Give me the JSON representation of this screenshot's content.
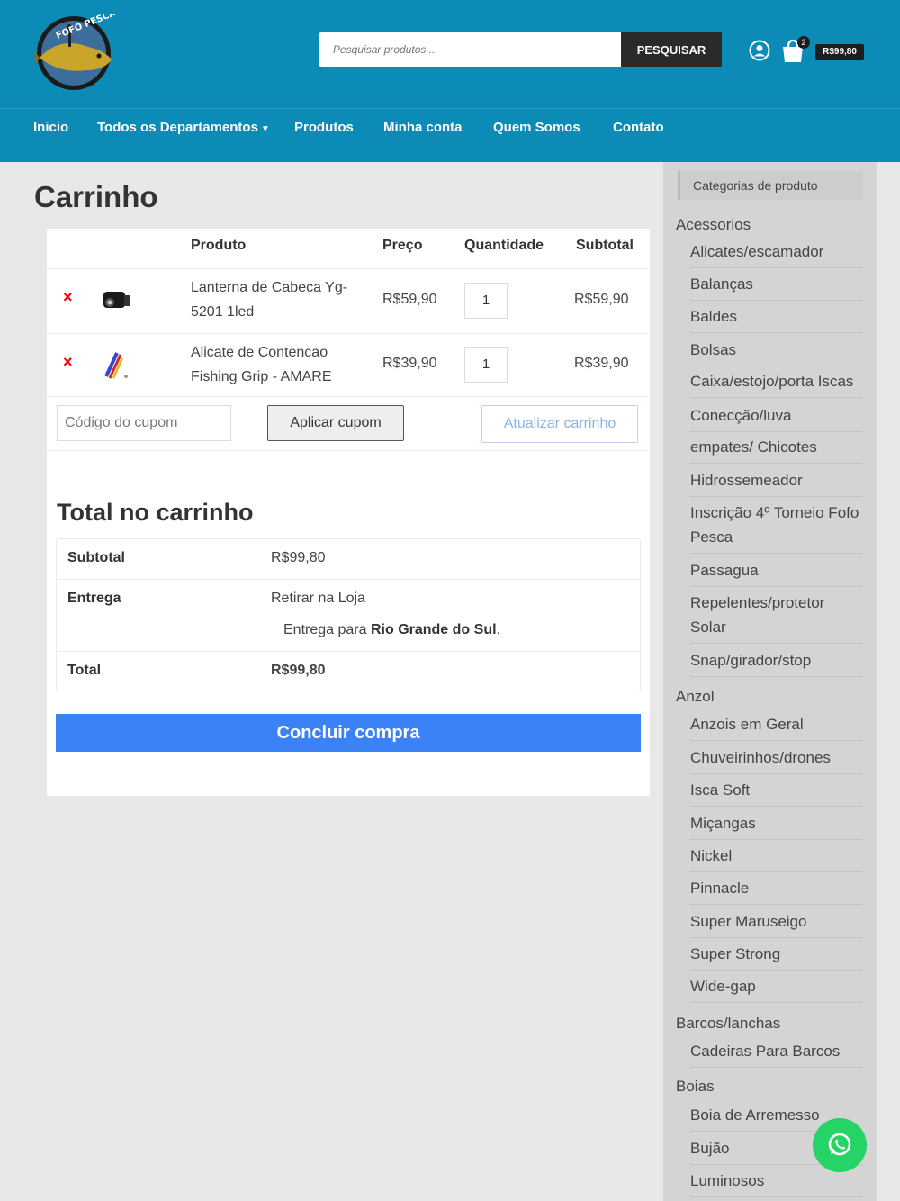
{
  "header": {
    "logo_text": "FOFO PESCA",
    "search_placeholder": "Pesquisar produtos ...",
    "search_button": "PESQUISAR",
    "cart_count": "2",
    "cart_total": "R$99,80"
  },
  "nav": {
    "items": [
      {
        "label": "Inicio"
      },
      {
        "label": "Todos os Departamentos"
      },
      {
        "label": "Produtos"
      },
      {
        "label": "Minha conta"
      },
      {
        "label": "Quem Somos"
      },
      {
        "label": "Contato"
      }
    ]
  },
  "page": {
    "title": "Carrinho"
  },
  "cart": {
    "headers": {
      "product": "Produto",
      "price": "Preço",
      "quantity": "Quantidade",
      "subtotal": "Subtotal"
    },
    "rows": [
      {
        "name": "Lanterna de Cabeca Yg-5201 1led",
        "price": "R$59,90",
        "qty": "1",
        "subtotal": "R$59,90",
        "remove": "×"
      },
      {
        "name": "Alicate de Contencao Fishing Grip - AMARE",
        "price": "R$39,90",
        "qty": "1",
        "subtotal": "R$39,90",
        "remove": "×"
      }
    ],
    "coupon_placeholder": "Código do cupom",
    "apply_coupon": "Aplicar cupom",
    "update_cart": "Atualizar carrinho"
  },
  "totals": {
    "title": "Total no carrinho",
    "subtotal_label": "Subtotal",
    "subtotal_value": "R$99,80",
    "shipping_label": "Entrega",
    "shipping_value": "Retirar na Loja",
    "shipping_note_prefix": "Entrega para",
    "shipping_note_place": "Rio Grande do Sul",
    "shipping_note_suffix": ".",
    "total_label": "Total",
    "total_value": "R$99,80",
    "checkout": "Concluir compra"
  },
  "sidebar": {
    "title": "Categorias de produto",
    "items": [
      {
        "label": "Acessorios",
        "level": "top"
      },
      {
        "label": "Alicates/escamador",
        "level": "sub"
      },
      {
        "label": "Balanças",
        "level": "sub"
      },
      {
        "label": "Baldes",
        "level": "sub"
      },
      {
        "label": "Bolsas",
        "level": "sub"
      },
      {
        "label": "Caixa/estojo/porta Iscas",
        "level": "sub"
      },
      {
        "label": "Conecção/luva",
        "level": "sub"
      },
      {
        "label": "empates/ Chicotes",
        "level": "sub"
      },
      {
        "label": "Hidrossemeador",
        "level": "sub"
      },
      {
        "label": "Inscrição 4º Torneio Fofo Pesca",
        "level": "sub"
      },
      {
        "label": "Passagua",
        "level": "sub"
      },
      {
        "label": "Repelentes/protetor Solar",
        "level": "sub"
      },
      {
        "label": "Snap/girador/stop",
        "level": "sub"
      },
      {
        "label": "Anzol",
        "level": "top"
      },
      {
        "label": "Anzois em Geral",
        "level": "sub"
      },
      {
        "label": "Chuveirinhos/drones",
        "level": "sub"
      },
      {
        "label": "Isca Soft",
        "level": "sub"
      },
      {
        "label": "Miçangas",
        "level": "sub"
      },
      {
        "label": "Nickel",
        "level": "sub"
      },
      {
        "label": "Pinnacle",
        "level": "sub"
      },
      {
        "label": "Super Maruseigo",
        "level": "sub"
      },
      {
        "label": "Super Strong",
        "level": "sub"
      },
      {
        "label": "Wide-gap",
        "level": "sub"
      },
      {
        "label": "Barcos/lanchas",
        "level": "top"
      },
      {
        "label": "Cadeiras Para Barcos",
        "level": "sub"
      },
      {
        "label": "Boias",
        "level": "top"
      },
      {
        "label": "Boia de Arremesso",
        "level": "sub"
      },
      {
        "label": "Bujão",
        "level": "sub"
      },
      {
        "label": "Luminosos",
        "level": "sub"
      }
    ]
  },
  "colors": {
    "header_bg": "#0b8bb5",
    "checkout_btn": "#3b82f6",
    "remove": "#e00000",
    "whatsapp": "#25d366"
  }
}
